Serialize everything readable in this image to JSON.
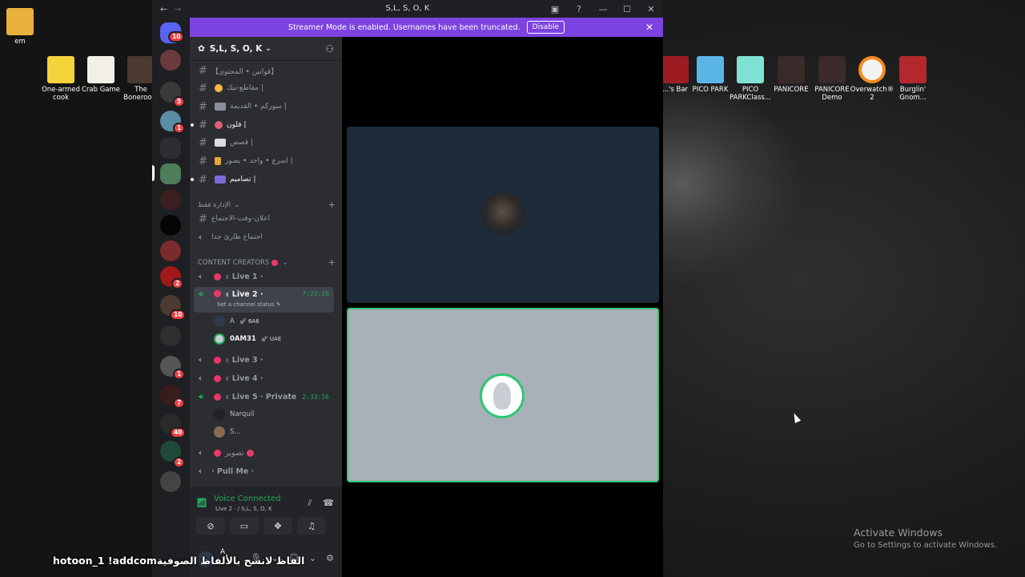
{
  "desktop": {
    "left_icons": [
      {
        "label": "em"
      },
      {
        "label": "One-armed cook"
      },
      {
        "label": "Crab Game"
      },
      {
        "label": "The Boneroom"
      }
    ],
    "right_icons": [
      {
        "label": "...'s Bar"
      },
      {
        "label": "PICO PARK"
      },
      {
        "label": "PICO PARKClass..."
      },
      {
        "label": "PANICORE"
      },
      {
        "label": "PANICORE Demo"
      },
      {
        "label": "Overwatch® 2"
      },
      {
        "label": "Burglin' Gnom..."
      }
    ],
    "activate_title": "Activate Windows",
    "activate_sub": "Go to Settings to activate Windows.",
    "overlay_text": "hotoon_1  !addcomالفاظ لانسح بالألفاظ الصوفية"
  },
  "window": {
    "title": "S,L, S, O, K",
    "banner_text": "Streamer Mode is enabled. Usernames have been truncated.",
    "banner_button": "Disable",
    "server_name": "S,L, S, O, K",
    "badges": {
      "home": "10",
      "g1": "5",
      "g2": "1",
      "g3": "2",
      "g4": "10",
      "g5": "1",
      "g6": "7",
      "g7": "40",
      "g8": "2"
    }
  },
  "channels": [
    {
      "name": "【قوانين • المحتوى】"
    },
    {
      "name": "مقاطع-تيك |"
    },
    {
      "name": "سوركم • القديمة |"
    },
    {
      "name": "فلون |"
    },
    {
      "name": "قصص |"
    },
    {
      "name": "اسرع • واحد • يصور |"
    },
    {
      "name": "تصاميم |"
    }
  ],
  "admin_category": "الإدارة فقط",
  "admin_channels": [
    {
      "name": "اعلان-وقت-الاجتماع"
    },
    {
      "name": "اجتماع طارئ جدا"
    }
  ],
  "content_category": "CONTENT CREATORS",
  "voice_channels": {
    "live1": "Live 1 ·",
    "live2": "Live 2 ·",
    "live2_time": "7:22:28",
    "live2_status": "Set a channel status",
    "live2_users": [
      {
        "name": "A",
        "tag": "6A6"
      },
      {
        "name": "0AM31",
        "tag": "UAE"
      }
    ],
    "live3": "Live 3 ·",
    "live4": "Live 4 ·",
    "live5": "Live 5 · Private",
    "live5_time": "2:33:16",
    "live5_users": [
      {
        "name": "Narquil"
      },
      {
        "name": "S..."
      }
    ],
    "taswir": "تصوير",
    "pullme": "· Pull Me ·"
  },
  "voice_panel": {
    "status": "Voice Connected",
    "sub": "Live 2 · / S,L, S, O, K"
  },
  "userbar": {
    "name": "A"
  }
}
